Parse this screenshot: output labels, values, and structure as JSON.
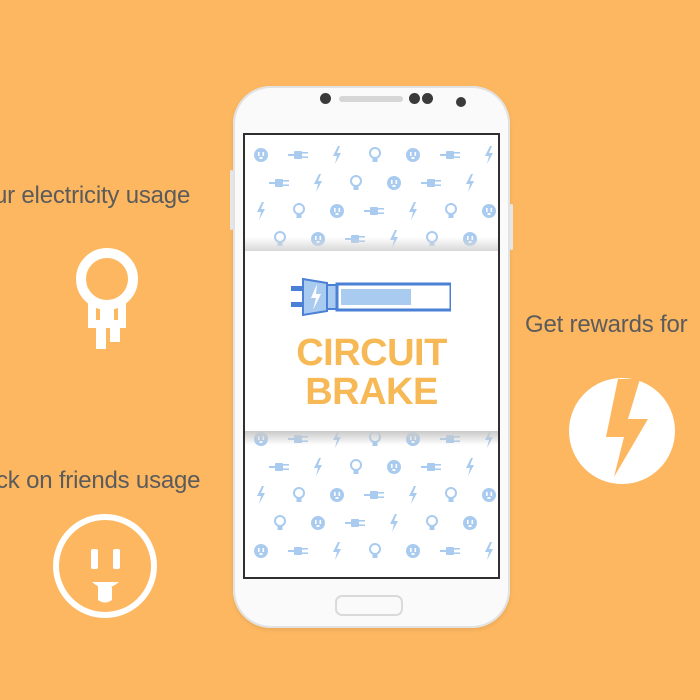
{
  "background_color": "#FDB760",
  "accent_color": "#F6B956",
  "icon_color": "#A9CBF0",
  "captions": {
    "left_top": "ur electricity usage",
    "left_bottom": "ck on friends usage",
    "right": "Get rewards for"
  },
  "side_icons": {
    "left_top": "lightbulb-icon",
    "left_bottom": "smiling-outlet-icon",
    "right": "lightning-bolt-icon"
  },
  "app": {
    "logo_icon": "plug-battery-icon",
    "title_line1": "CIRCUIT",
    "title_line2": "BRAKE"
  },
  "pattern_icons": [
    "outlet-icon",
    "plug-icon",
    "bolt-icon",
    "bulb-icon"
  ]
}
